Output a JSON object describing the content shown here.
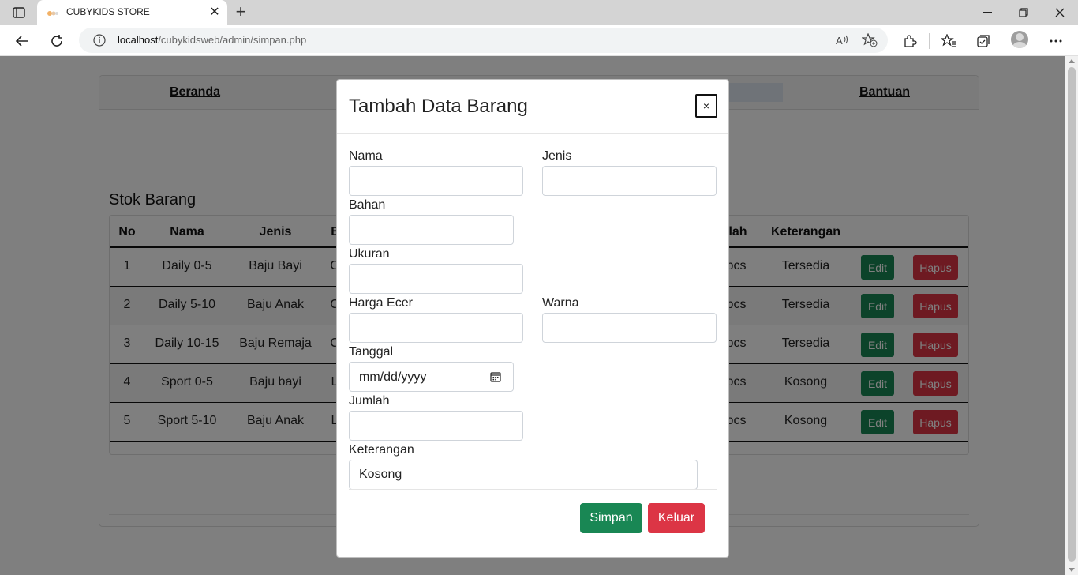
{
  "browser": {
    "tab_title": "CUBYKIDS STORE",
    "url_host": "localhost",
    "url_path": "/cubykidsweb/admin/simpan.php"
  },
  "page": {
    "nav": {
      "home": "Beranda",
      "help": "Bantuan"
    },
    "stock_title": "Stok Barang",
    "table": {
      "headers": [
        "No",
        "Nama",
        "Jenis",
        "B",
        "lah",
        "Keterangan"
      ],
      "rows": [
        {
          "no": "1",
          "nama": "Daily 0-5",
          "jenis": "Baju Bayi",
          "bahan": "C",
          "jumlah": "pcs",
          "keterangan": "Tersedia"
        },
        {
          "no": "2",
          "nama": "Daily 5-10",
          "jenis": "Baju Anak",
          "bahan": "C",
          "jumlah": "pcs",
          "keterangan": "Tersedia"
        },
        {
          "no": "3",
          "nama": "Daily 10-15",
          "jenis": "Baju Remaja",
          "bahan": "C",
          "jumlah": "pcs",
          "keterangan": "Tersedia"
        },
        {
          "no": "4",
          "nama": "Sport 0-5",
          "jenis": "Baju bayi",
          "bahan": "L",
          "jumlah": "ocs",
          "keterangan": "Kosong"
        },
        {
          "no": "5",
          "nama": "Sport 5-10",
          "jenis": "Baju Anak",
          "bahan": "L",
          "jumlah": "ocs",
          "keterangan": "Kosong"
        }
      ],
      "edit_label": "Edit",
      "delete_label": "Hapus"
    }
  },
  "modal": {
    "title": "Tambah Data Barang",
    "close_label": "×",
    "fields": {
      "nama": {
        "label": "Nama",
        "value": ""
      },
      "jenis": {
        "label": "Jenis",
        "value": ""
      },
      "bahan": {
        "label": "Bahan",
        "value": ""
      },
      "ukuran": {
        "label": "Ukuran",
        "value": ""
      },
      "harga": {
        "label": "Harga Ecer",
        "value": ""
      },
      "warna": {
        "label": "Warna",
        "value": ""
      },
      "tanggal": {
        "label": "Tanggal",
        "placeholder": "mm/dd/yyyy"
      },
      "jumlah": {
        "label": "Jumlah",
        "value": ""
      },
      "keterangan": {
        "label": "Keterangan",
        "value": "Kosong"
      }
    },
    "save_label": "Simpan",
    "exit_label": "Keluar"
  },
  "colors": {
    "success": "#198754",
    "danger": "#dc3545"
  }
}
